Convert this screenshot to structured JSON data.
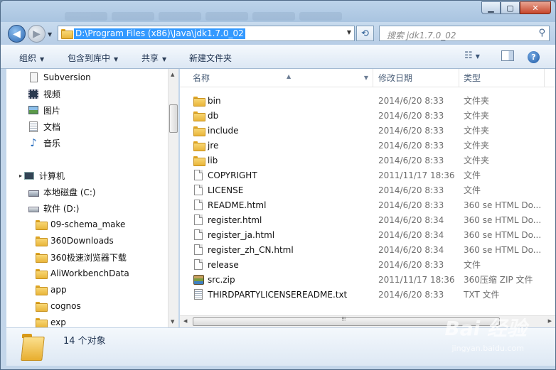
{
  "window": {
    "minimize": "▁",
    "maximize": "▢",
    "close": "✕"
  },
  "nav": {
    "back": "◀",
    "forward": "▶",
    "address": "D:\\Program Files (x86)\\Java\\jdk1.7.0_02",
    "search_placeholder": "搜索 jdk1.7.0_02",
    "refresh": "⟲"
  },
  "toolbar": {
    "organize": "组织",
    "include_in_library": "包含到库中",
    "share": "共享",
    "new_folder": "新建文件夹",
    "help": "?"
  },
  "sidebar": {
    "favorites": [
      {
        "label": "Subversion",
        "icon": "subversion-icon"
      },
      {
        "label": "视频",
        "icon": "video-icon"
      },
      {
        "label": "图片",
        "icon": "picture-icon"
      },
      {
        "label": "文档",
        "icon": "document-icon"
      },
      {
        "label": "音乐",
        "icon": "music-icon"
      }
    ],
    "computer": "计算机",
    "drives": [
      {
        "label": "本地磁盘 (C:)",
        "icon": "local-disk-icon"
      },
      {
        "label": "软件 (D:)",
        "icon": "drive-icon"
      }
    ],
    "folders": [
      "09-schema_make",
      "360Downloads",
      "360极速浏览器下载",
      "AliWorkbenchData",
      "app",
      "cognos",
      "exp"
    ]
  },
  "columns": {
    "name": "名称",
    "date": "修改日期",
    "type": "类型"
  },
  "files": [
    {
      "name": "bin",
      "date": "2014/6/20 8:33",
      "type": "文件夹",
      "icon": "folder"
    },
    {
      "name": "db",
      "date": "2014/6/20 8:33",
      "type": "文件夹",
      "icon": "folder"
    },
    {
      "name": "include",
      "date": "2014/6/20 8:33",
      "type": "文件夹",
      "icon": "folder"
    },
    {
      "name": "jre",
      "date": "2014/6/20 8:33",
      "type": "文件夹",
      "icon": "folder"
    },
    {
      "name": "lib",
      "date": "2014/6/20 8:33",
      "type": "文件夹",
      "icon": "folder"
    },
    {
      "name": "COPYRIGHT",
      "date": "2011/11/17 18:36",
      "type": "文件",
      "icon": "doc"
    },
    {
      "name": "LICENSE",
      "date": "2014/6/20 8:33",
      "type": "文件",
      "icon": "doc"
    },
    {
      "name": "README.html",
      "date": "2014/6/20 8:33",
      "type": "360 se HTML Do...",
      "icon": "doc"
    },
    {
      "name": "register.html",
      "date": "2014/6/20 8:34",
      "type": "360 se HTML Do...",
      "icon": "doc"
    },
    {
      "name": "register_ja.html",
      "date": "2014/6/20 8:34",
      "type": "360 se HTML Do...",
      "icon": "doc"
    },
    {
      "name": "register_zh_CN.html",
      "date": "2014/6/20 8:34",
      "type": "360 se HTML Do...",
      "icon": "doc"
    },
    {
      "name": "release",
      "date": "2014/6/20 8:33",
      "type": "文件",
      "icon": "doc"
    },
    {
      "name": "src.zip",
      "date": "2011/11/17 18:36",
      "type": "360压缩 ZIP 文件",
      "icon": "zip"
    },
    {
      "name": "THIRDPARTYLICENSEREADME.txt",
      "date": "2014/6/20 8:33",
      "type": "TXT 文件",
      "icon": "txt"
    }
  ],
  "status": {
    "count": "14 个对象"
  },
  "watermark": {
    "text": "Bai 经验",
    "sub": "jingyan.baidu.com"
  }
}
